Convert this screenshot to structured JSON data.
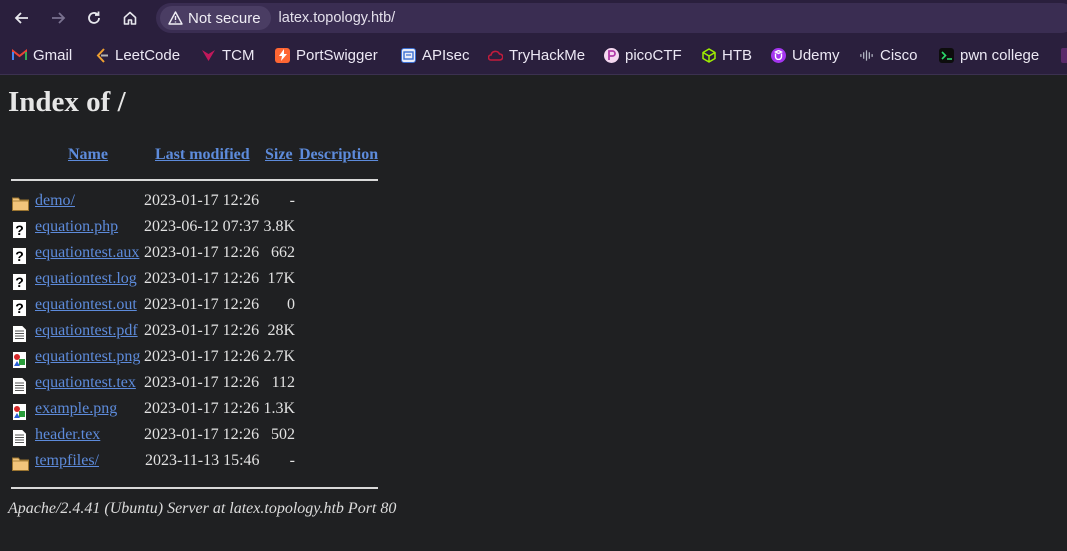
{
  "browser": {
    "security_label": "Not secure",
    "url": "latex.topology.htb/"
  },
  "bookmarks": [
    {
      "label": "Gmail",
      "icon": "gmail-icon",
      "color": "#ea4335"
    },
    {
      "label": "LeetCode",
      "icon": "leetcode-icon",
      "color": "#f0a030"
    },
    {
      "label": "TCM",
      "icon": "tcm-icon",
      "color": "#c2185b"
    },
    {
      "label": "PortSwigger",
      "icon": "portswigger-icon",
      "color": "#ff6633"
    },
    {
      "label": "APIsec",
      "icon": "apisec-icon",
      "color": "#3b6fd4"
    },
    {
      "label": "TryHackMe",
      "icon": "tryhackme-icon",
      "color": "#c11c3c"
    },
    {
      "label": "picoCTF",
      "icon": "picoctf-icon",
      "color": "#b03aa8"
    },
    {
      "label": "HTB",
      "icon": "htb-icon",
      "color": "#9fef00"
    },
    {
      "label": "Udemy",
      "icon": "udemy-icon",
      "color": "#a435f0"
    },
    {
      "label": "Cisco",
      "icon": "cisco-icon",
      "color": "#1ba0d7"
    },
    {
      "label": "pwn college",
      "icon": "pwn-college-icon",
      "color": "#2bd96b"
    }
  ],
  "page": {
    "title": "Index of /",
    "headers": {
      "name": "Name",
      "last_modified": "Last modified",
      "size": "Size",
      "description": "Description"
    },
    "files": [
      {
        "name": "demo/",
        "date": "2023-01-17 12:26",
        "size": "-",
        "type": "folder"
      },
      {
        "name": "equation.php",
        "date": "2023-06-12 07:37",
        "size": "3.8K",
        "type": "unknown"
      },
      {
        "name": "equationtest.aux",
        "date": "2023-01-17 12:26",
        "size": "662",
        "type": "unknown"
      },
      {
        "name": "equationtest.log",
        "date": "2023-01-17 12:26",
        "size": "17K",
        "type": "unknown"
      },
      {
        "name": "equationtest.out",
        "date": "2023-01-17 12:26",
        "size": "0",
        "type": "unknown"
      },
      {
        "name": "equationtest.pdf",
        "date": "2023-01-17 12:26",
        "size": "28K",
        "type": "text"
      },
      {
        "name": "equationtest.png",
        "date": "2023-01-17 12:26",
        "size": "2.7K",
        "type": "image"
      },
      {
        "name": "equationtest.tex",
        "date": "2023-01-17 12:26",
        "size": "112",
        "type": "text"
      },
      {
        "name": "example.png",
        "date": "2023-01-17 12:26",
        "size": "1.3K",
        "type": "image"
      },
      {
        "name": "header.tex",
        "date": "2023-01-17 12:26",
        "size": "502",
        "type": "text"
      },
      {
        "name": "tempfiles/",
        "date": "2023-11-13 15:46",
        "size": "-",
        "type": "folder"
      }
    ],
    "footer": "Apache/2.4.41 (Ubuntu) Server at latex.topology.htb Port 80"
  }
}
